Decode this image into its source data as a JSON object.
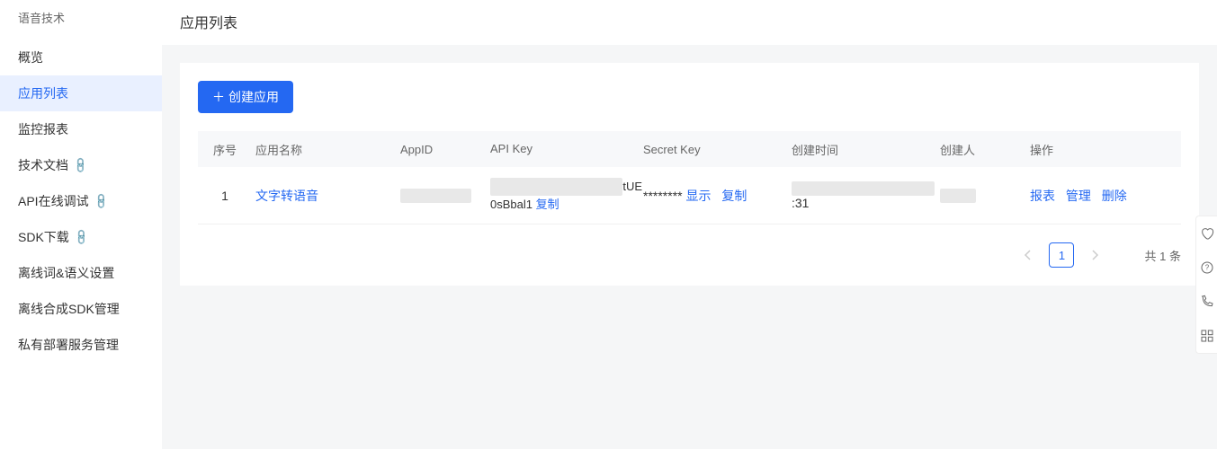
{
  "sidebar": {
    "title": "语音技术",
    "items": [
      {
        "label": "概览",
        "active": false,
        "external": false
      },
      {
        "label": "应用列表",
        "active": true,
        "external": false
      },
      {
        "label": "监控报表",
        "active": false,
        "external": false
      },
      {
        "label": "技术文档",
        "active": false,
        "external": true
      },
      {
        "label": "API在线调试",
        "active": false,
        "external": true
      },
      {
        "label": "SDK下载",
        "active": false,
        "external": true
      },
      {
        "label": "离线词&语义设置",
        "active": false,
        "external": false
      },
      {
        "label": "离线合成SDK管理",
        "active": false,
        "external": false
      },
      {
        "label": "私有部署服务管理",
        "active": false,
        "external": false
      }
    ]
  },
  "page": {
    "title": "应用列表",
    "create_button": "创建应用"
  },
  "table": {
    "headers": {
      "seq": "序号",
      "name": "应用名称",
      "appid": "AppID",
      "apikey": "API Key",
      "secret": "Secret Key",
      "time": "创建时间",
      "creator": "创建人",
      "actions": "操作"
    },
    "rows": [
      {
        "seq": "1",
        "name": "文字转语音",
        "appid_redacted": "████████",
        "apikey_prefix_redacted": "████████████████",
        "apikey_suffix": "tUE0sBbal1",
        "apikey_copy": "复制",
        "secret_masked": "********",
        "secret_show": "显示",
        "secret_copy": "复制",
        "time_redacted": "████████████████",
        "time_suffix": ":31",
        "creator_redacted": "████",
        "actions": {
          "report": "报表",
          "manage": "管理",
          "delete": "删除"
        }
      }
    ]
  },
  "pagination": {
    "current": "1",
    "total_prefix": "共",
    "total_count": "1",
    "total_suffix": "条"
  }
}
